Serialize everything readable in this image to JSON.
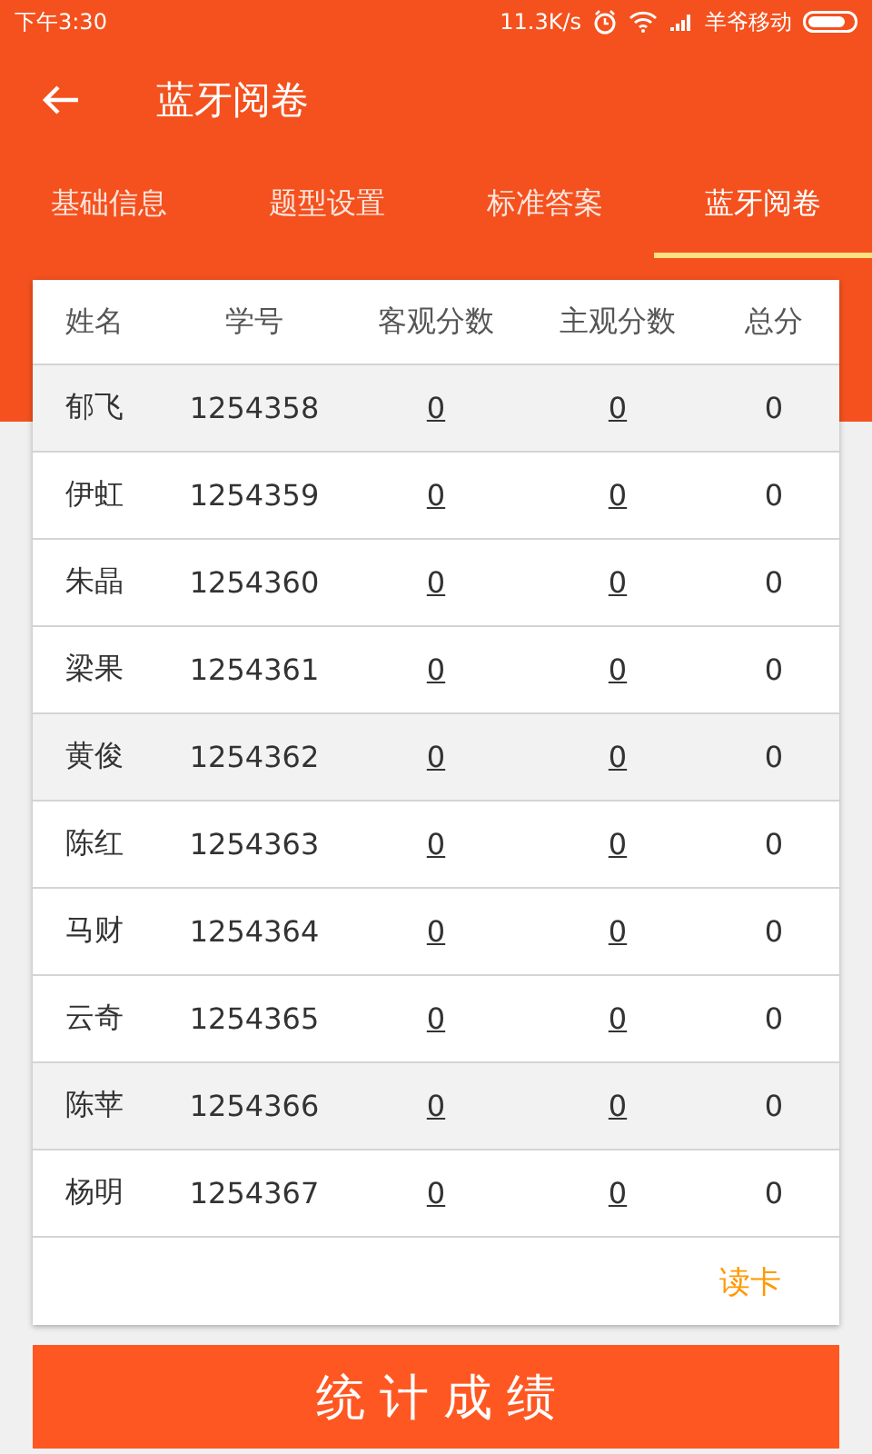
{
  "status_bar": {
    "time": "下午3:30",
    "speed": "11.3K/s",
    "carrier": "羊爷移动"
  },
  "app_bar": {
    "title": "蓝牙阅卷"
  },
  "tabs": [
    {
      "label": "基础信息",
      "selected": false
    },
    {
      "label": "题型设置",
      "selected": false
    },
    {
      "label": "标准答案",
      "selected": false
    },
    {
      "label": "蓝牙阅卷",
      "selected": true
    }
  ],
  "table": {
    "columns": [
      "姓名",
      "学号",
      "客观分数",
      "主观分数",
      "总分"
    ],
    "rows": [
      {
        "name": "郁飞",
        "id": "1254358",
        "objective": "0",
        "subjective": "0",
        "total": "0",
        "shaded": true
      },
      {
        "name": "伊虹",
        "id": "1254359",
        "objective": "0",
        "subjective": "0",
        "total": "0",
        "shaded": false
      },
      {
        "name": "朱晶",
        "id": "1254360",
        "objective": "0",
        "subjective": "0",
        "total": "0",
        "shaded": false
      },
      {
        "name": "梁果",
        "id": "1254361",
        "objective": "0",
        "subjective": "0",
        "total": "0",
        "shaded": false
      },
      {
        "name": "黄俊",
        "id": "1254362",
        "objective": "0",
        "subjective": "0",
        "total": "0",
        "shaded": true
      },
      {
        "name": "陈红",
        "id": "1254363",
        "objective": "0",
        "subjective": "0",
        "total": "0",
        "shaded": false
      },
      {
        "name": "马财",
        "id": "1254364",
        "objective": "0",
        "subjective": "0",
        "total": "0",
        "shaded": false
      },
      {
        "name": "云奇",
        "id": "1254365",
        "objective": "0",
        "subjective": "0",
        "total": "0",
        "shaded": false
      },
      {
        "name": "陈苹",
        "id": "1254366",
        "objective": "0",
        "subjective": "0",
        "total": "0",
        "shaded": true
      },
      {
        "name": "杨明",
        "id": "1254367",
        "objective": "0",
        "subjective": "0",
        "total": "0",
        "shaded": false
      }
    ],
    "footer_link": "读卡"
  },
  "primary_button": "统计成绩"
}
